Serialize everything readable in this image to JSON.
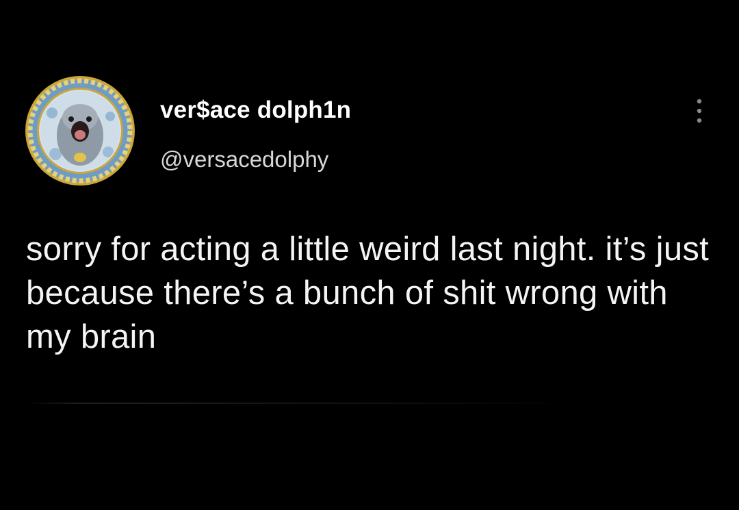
{
  "tweet": {
    "display_name": "ver$ace dolph1n",
    "handle": "@versacedolphy",
    "text": "sorry for acting a little weird last night. it’s just because there’s a bunch of shit wrong with my brain",
    "avatar_icon": "versace-dolphin-avatar-icon",
    "more_icon": "more-vertical-icon"
  },
  "colors": {
    "background": "#000000",
    "text": "#ffffff",
    "handle": "#d8d8d8",
    "avatar_ring": "#c9a23a",
    "avatar_bg": "#c9d9e6"
  }
}
